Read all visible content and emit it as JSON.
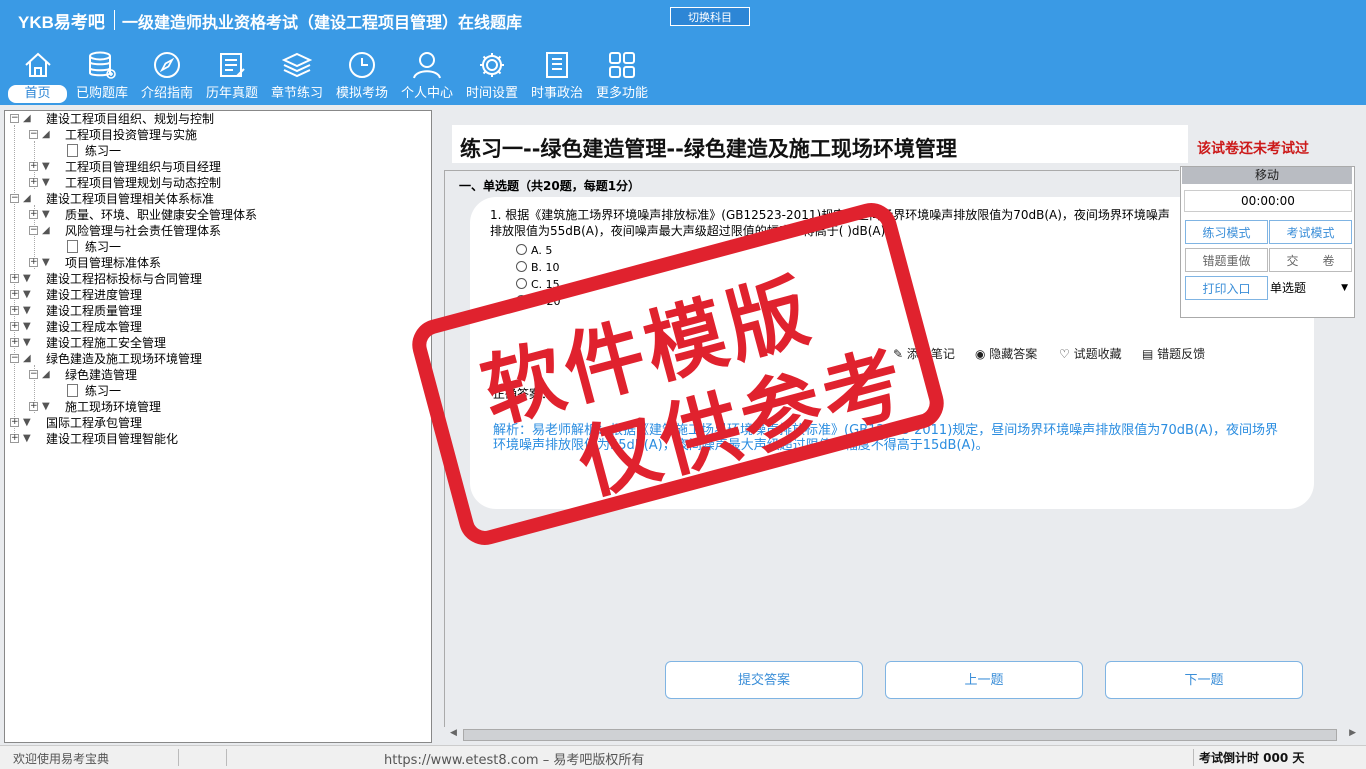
{
  "header": {
    "logo": "YKB易考吧",
    "title": "一级建造师执业资格考试（建设工程项目管理）在线题库",
    "switch_label": "切换科目"
  },
  "nav": [
    {
      "label": "首页",
      "icon": "home-icon"
    },
    {
      "label": "已购题库",
      "icon": "database-icon"
    },
    {
      "label": "介绍指南",
      "icon": "compass-icon"
    },
    {
      "label": "历年真题",
      "icon": "list-icon"
    },
    {
      "label": "章节练习",
      "icon": "layers-icon"
    },
    {
      "label": "模拟考场",
      "icon": "clock-icon"
    },
    {
      "label": "个人中心",
      "icon": "user-icon"
    },
    {
      "label": "时间设置",
      "icon": "gear-icon"
    },
    {
      "label": "时事政治",
      "icon": "notebook-icon"
    },
    {
      "label": "更多功能",
      "icon": "grid-icon"
    }
  ],
  "tree": [
    "建设工程项目组织、规划与控制",
    "工程项目投资管理与实施",
    "练习一",
    "工程项目管理组织与项目经理",
    "工程项目管理规划与动态控制",
    "建设工程项目管理相关体系标准",
    "质量、环境、职业健康安全管理体系",
    "风险管理与社会责任管理体系",
    "练习一",
    "项目管理标准体系",
    "建设工程招标投标与合同管理",
    "建设工程进度管理",
    "建设工程质量管理",
    "建设工程成本管理",
    "建设工程施工安全管理",
    "绿色建造及施工现场环境管理",
    "绿色建造管理",
    "练习一",
    "施工现场环境管理",
    "国际工程承包管理",
    "建设工程项目管理智能化"
  ],
  "exercise": {
    "title": "练习一--绿色建造管理--绿色建造及施工现场环境管理",
    "status": "该试卷还未考试过",
    "section": "一、单选题（共20题，每题1分）",
    "question": "1. 根据《建筑施工场界环境噪声排放标准》(GB12523-2011)规定，昼间场界环境噪声排放限值为70dB(A)，夜间场界环境噪声排放限值为55dB(A)，夜间噪声最大声级超过限值的幅度不得高于( )dB(A)。",
    "options": [
      "A. 5",
      "B. 10",
      "C. 15",
      "D. 20"
    ],
    "tools": [
      "添加笔记",
      "隐藏答案",
      "试题收藏",
      "错题反馈"
    ],
    "answer_label": "正确答案：",
    "analysis": "解析：易老师解析：根据《建筑施工场界环境噪声排放标准》(GB12523-2011)规定，昼间场界环境噪声排放限值为70dB(A)，夜间场界环境噪声排放限值为55dB(A)，夜间噪声最大声级超过限值的幅度不得高于15dB(A)。"
  },
  "control": {
    "move": "移动",
    "timer": "00:00:00",
    "practice_mode": "练习模式",
    "exam_mode": "考试模式",
    "redo_wrong": "错题重做",
    "submit_paper": "交　　卷",
    "print": "打印入口",
    "type_select": "单选题"
  },
  "bottom_buttons": {
    "submit": "提交答案",
    "prev": "上一题",
    "next": "下一题"
  },
  "statusbar": {
    "welcome": "欢迎使用易考宝典",
    "copyright": "https://www.etest8.com – 易考吧版权所有",
    "countdown": "考试倒计时 000 天"
  },
  "watermark": {
    "line1": "软件模版",
    "line2": "仅供参考"
  }
}
